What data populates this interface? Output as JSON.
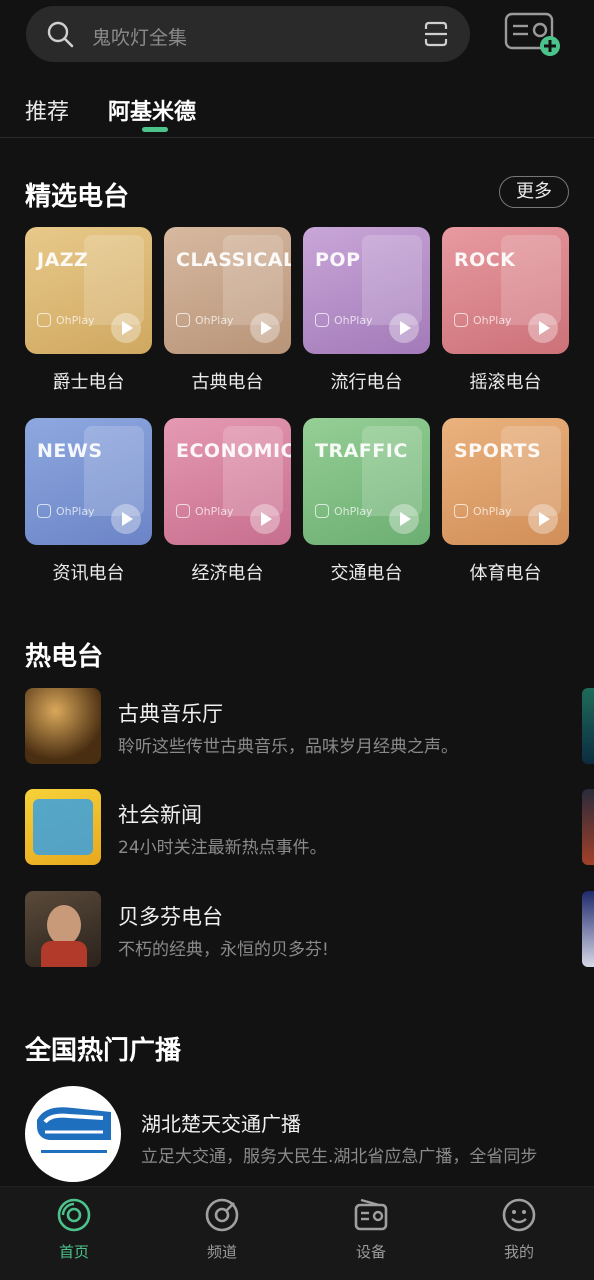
{
  "search": {
    "placeholder": "鬼吹灯全集"
  },
  "tabs": [
    {
      "label": "推荐"
    },
    {
      "label": "阿基米德"
    }
  ],
  "featured": {
    "title": "精选电台",
    "more_label": "更多",
    "brand": "OhPlay",
    "stations": [
      {
        "genre": "JAZZ",
        "label": "爵士电台",
        "color_from": "#e8c98a",
        "color_to": "#cfa860"
      },
      {
        "genre": "CLASSICAL",
        "label": "古典电台",
        "color_from": "#d7b9a0",
        "color_to": "#b89478"
      },
      {
        "genre": "POP",
        "label": "流行电台",
        "color_from": "#c9a6d8",
        "color_to": "#a27ab8"
      },
      {
        "genre": "ROCK",
        "label": "摇滚电台",
        "color_from": "#e79aa0",
        "color_to": "#cc7178"
      },
      {
        "genre": "NEWS",
        "label": "资讯电台",
        "color_from": "#8ea8e0",
        "color_to": "#6b84c6"
      },
      {
        "genre": "ECONOMICS",
        "label": "经济电台",
        "color_from": "#e59ab2",
        "color_to": "#c76e8e"
      },
      {
        "genre": "TRAFFIC",
        "label": "交通电台",
        "color_from": "#95cf95",
        "color_to": "#6cae72"
      },
      {
        "genre": "SPORTS",
        "label": "体育电台",
        "color_from": "#eab27e",
        "color_to": "#d18e58"
      }
    ]
  },
  "hot": {
    "title": "热电台",
    "items": [
      {
        "name": "古典音乐厅",
        "desc": "聆听这些传世古典音乐，品味岁月经典之声。",
        "thumb_color": "#6b4a24"
      },
      {
        "name": "社会新闻",
        "desc": "24小时关注最新热点事件。",
        "thumb_color": "#f2c32e"
      },
      {
        "name": "贝多芬电台",
        "desc": "不朽的经典，永恒的贝多芬!",
        "thumb_color": "#3a3026"
      }
    ]
  },
  "national": {
    "title": "全国热门广播",
    "items": [
      {
        "name": "湖北楚天交通广播",
        "desc": "立足大交通，服务大民生.湖北省应急广播，全省同步"
      }
    ]
  },
  "bottom_nav": [
    {
      "label": "首页",
      "icon": "home-disc-icon",
      "active": true
    },
    {
      "label": "频道",
      "icon": "channel-disc-icon",
      "active": false
    },
    {
      "label": "设备",
      "icon": "radio-device-icon",
      "active": false
    },
    {
      "label": "我的",
      "icon": "smiley-icon",
      "active": false
    }
  ],
  "colors": {
    "accent": "#4cc38a",
    "background": "#121212"
  }
}
